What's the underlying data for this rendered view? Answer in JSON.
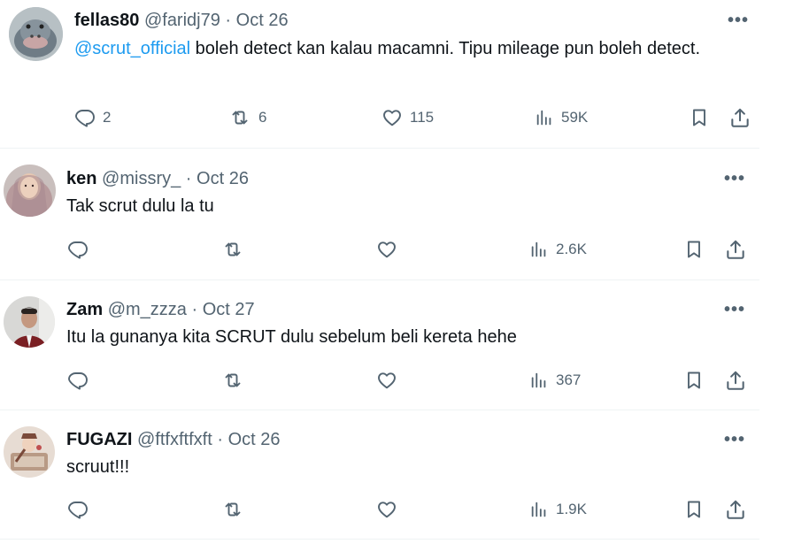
{
  "tweets": [
    {
      "name": "fellas80",
      "handle": "@faridj79",
      "date": "Oct 26",
      "mention": "@scrut_official",
      "text": " boleh detect kan kalau macamni. Tipu mileage pun boleh detect.",
      "replies": "2",
      "retweets": "6",
      "likes": "115",
      "views": "59K"
    },
    {
      "name": "ken",
      "handle": "@missry_",
      "date": "Oct 26",
      "text": "Tak scrut dulu la tu",
      "views": "2.6K"
    },
    {
      "name": "Zam",
      "handle": "@m_zzza",
      "date": "Oct 27",
      "text": "Itu la gunanya kita SCRUT dulu sebelum beli kereta hehe",
      "views": "367"
    },
    {
      "name": "FUGAZI",
      "handle": "@ftfxftfxft",
      "date": "Oct 26",
      "text": "scruut!!!",
      "views": "1.9K"
    }
  ],
  "separator": "·",
  "more_glyph": "•••",
  "colors": {
    "text": "#0f1419",
    "muted": "#536471",
    "link": "#1d9bf0",
    "divider": "#eff3f4"
  },
  "icons": [
    "reply-icon",
    "retweet-icon",
    "like-icon",
    "views-icon",
    "bookmark-icon",
    "share-icon",
    "more-icon"
  ]
}
